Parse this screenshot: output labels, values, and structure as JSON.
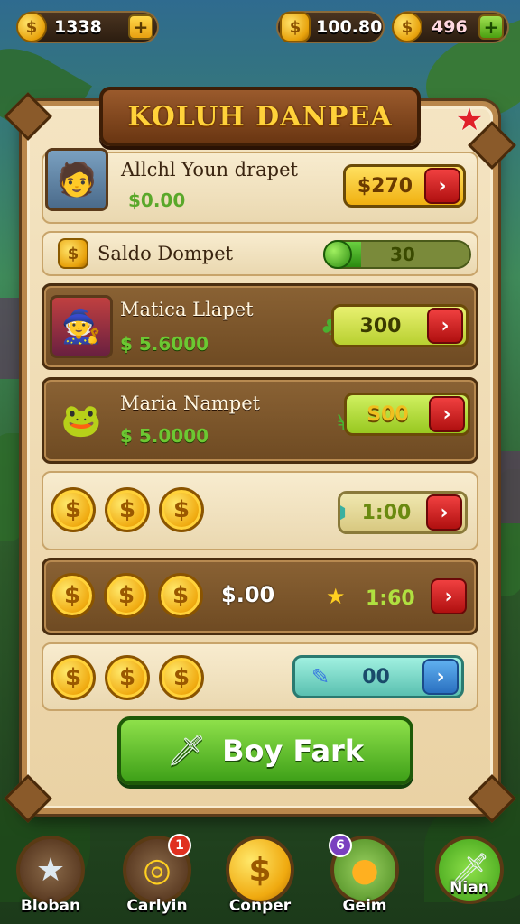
{
  "top_bar": {
    "left_value": "1338",
    "middle_value": "100.80",
    "right_value": "496",
    "plus_symbol": "+"
  },
  "panel": {
    "title": "KOLUH DANPEA"
  },
  "rows": [
    {
      "name": "Allchl Youn drapet",
      "price": "$0.00",
      "button": "$270"
    },
    {
      "name": "Saldo Dompet",
      "progress_value": "30",
      "progress_fraction": 0.25
    },
    {
      "name": "Matica Llapet",
      "price": "$ 5.6000",
      "button": "300"
    },
    {
      "name": "Maria Nampet",
      "price": "$ 5.0000",
      "button": "S00"
    },
    {
      "timer": "1:00"
    },
    {
      "amount": "$.00",
      "timer": "1:60"
    },
    {
      "button": "00"
    }
  ],
  "coin_symbol": "$",
  "arrow_symbol": "›",
  "main_button": {
    "label": "Boy Fark"
  },
  "nav": [
    {
      "label": "Bloban",
      "icon": "star-icon"
    },
    {
      "label": "Carlyin",
      "icon": "coin-stack-icon",
      "badge": "1"
    },
    {
      "label": "Conper",
      "icon": "coin-icon"
    },
    {
      "label": "Geim",
      "icon": "fruit-icon",
      "badge": "6"
    },
    {
      "label": "Nian",
      "icon": "sword-icon"
    }
  ],
  "colors": {
    "gold": "#f0aa10",
    "green_button": "#3ea018",
    "red_arrow": "#d02020",
    "panel_bg": "#f4e4c2",
    "wood": "#8a5a2a"
  }
}
